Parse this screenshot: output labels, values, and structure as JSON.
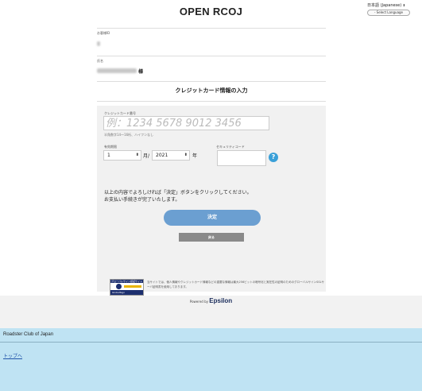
{
  "header": {
    "title": "OPEN RCOJ",
    "language_select": "日本語 (Japanese)",
    "select_language_label": "- Select Language"
  },
  "customer": {
    "number_label": "お客様ID",
    "name_label": "氏名",
    "honorific": "様"
  },
  "section_title": "クレジットカード情報の入力",
  "form": {
    "card_number_label": "クレジットカード番号",
    "card_number_placeholder": "例：1234 5678 9012 3456",
    "card_number_note": "半角数字14～16桁、ハイフンなし",
    "expiry_label": "有効期限",
    "expiry_month": "1",
    "expiry_month_unit": "月/",
    "expiry_year": "2021",
    "expiry_year_unit": "年",
    "security_code_label": "セキュリティコード",
    "help_icon_glyph": "?"
  },
  "confirm_text": [
    "以上の内容でよろしければ「決定」ボタンをクリックしてください。",
    "お支払い手続きが完了いたします。"
  ],
  "buttons": {
    "confirm": "決定",
    "back": "戻る"
  },
  "seal": {
    "top_text": "グローバルサイン認証サイト",
    "bottom_text": "GlobalSign"
  },
  "ssl_note": "当サイトでは、個人情報やクレジットカード情報などの重要な情報は最大256ビットの暗号化と実在性の証明のためのグローバルサインSSLサーバ証明書を使用しております。",
  "powered_by": {
    "label": "Powered by",
    "brand": "Epsilon"
  },
  "footer": {
    "org_name": "Roadster Club of Japan",
    "top_link": "トップへ"
  },
  "colors": {
    "confirm_button": "#6b9fd1",
    "back_button": "#8a8a8a",
    "help_icon": "#3aa0d8",
    "footer_bg": "#bfe3f3"
  }
}
